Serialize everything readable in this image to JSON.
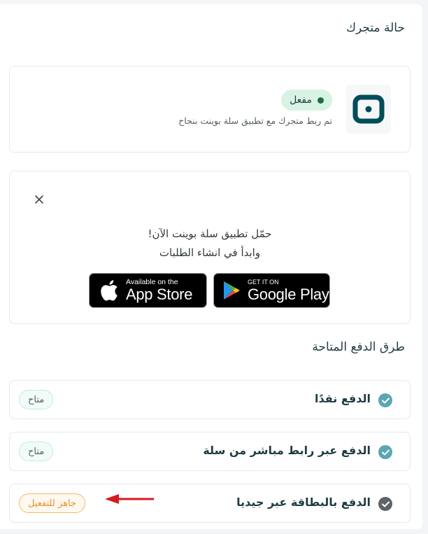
{
  "store_status": {
    "title": "حالة متجرك",
    "badge": "مفعل",
    "description": "تم ربط متجرك مع تطبيق سلة بوينت بنجاح"
  },
  "download": {
    "line1": "حمّل تطبيق سلة بوينت الآن!",
    "line2": "وابدأ في انشاء الطلبات",
    "app_store": {
      "small": "Available on the",
      "big": "App Store"
    },
    "google_play": {
      "small": "GET IT ON",
      "big": "Google Play"
    }
  },
  "payment_methods": {
    "title": "طرق الدفع المتاحة",
    "items": [
      {
        "label": "الدفع نقدًا",
        "badge": "متاح",
        "status": "available"
      },
      {
        "label": "الدفع عبر رابط مباشر من سلة",
        "badge": "متاح",
        "status": "available"
      },
      {
        "label": "الدفع بالبطاقة عبر جيديا",
        "badge": "جاهز للتفعيل",
        "status": "ready"
      }
    ]
  },
  "colors": {
    "brand": "#004d5a",
    "active_badge_bg": "#d7f3e3",
    "active_dot": "#1e6b44",
    "check_available": "#5aa7b3",
    "check_ready": "#5f6366",
    "ready_badge": "#e5952f",
    "annotation_arrow": "#d71920"
  }
}
